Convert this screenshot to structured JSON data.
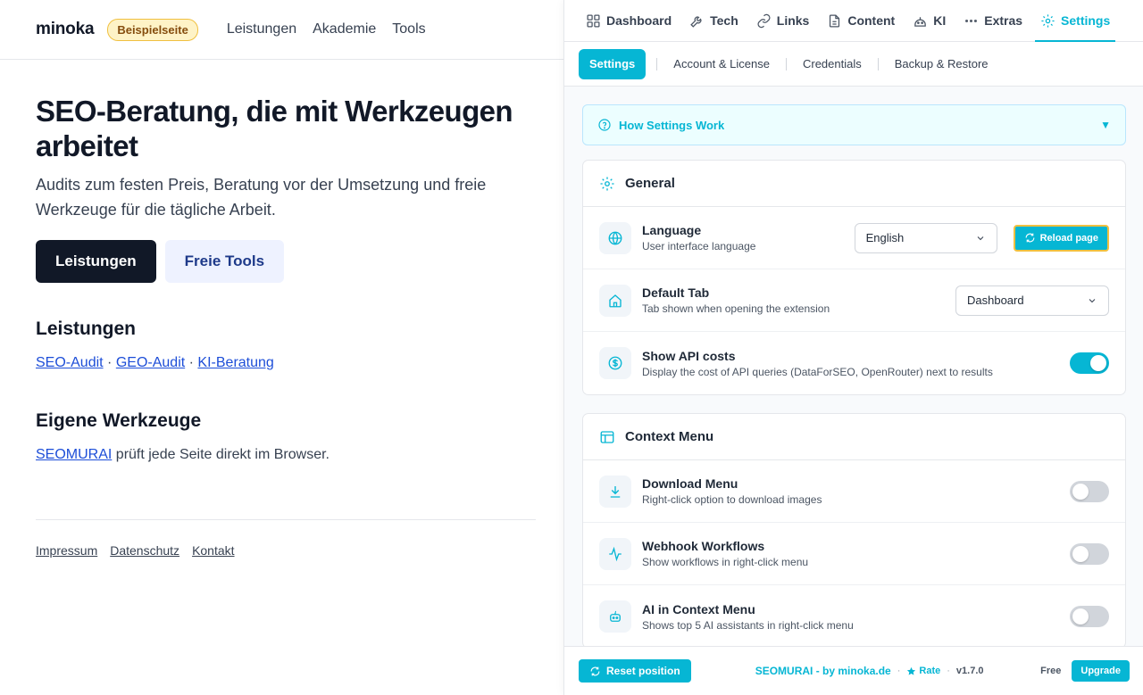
{
  "site": {
    "logo": "minoka",
    "badge": "Beispielseite",
    "nav": [
      "Leistungen",
      "Akademie",
      "Tools"
    ],
    "hero_title": "SEO-Beratung, die mit Werkzeugen arbeitet",
    "hero_sub": "Audits zum festen Preis, Beratung vor der Umsetzung und freie Werkzeuge für die tägliche Arbeit.",
    "cta_primary": "Leistungen",
    "cta_secondary": "Freie Tools",
    "services_heading": "Leistungen",
    "services_links": [
      "SEO-Audit",
      "GEO-Audit",
      "KI-Beratung"
    ],
    "separator": "·",
    "tools_heading": "Eigene Werkzeuge",
    "tools_link": "SEOMURAI",
    "tools_text": " prüft jede Seite direkt im Browser.",
    "footer": [
      "Impressum",
      "Datenschutz",
      "Kontakt"
    ]
  },
  "panel": {
    "tabs": [
      {
        "label": "Dashboard",
        "icon": "grid-icon"
      },
      {
        "label": "Tech",
        "icon": "wrench-icon"
      },
      {
        "label": "Links",
        "icon": "link-icon"
      },
      {
        "label": "Content",
        "icon": "document-icon"
      },
      {
        "label": "KI",
        "icon": "robot-icon"
      },
      {
        "label": "Extras",
        "icon": "dots-icon"
      },
      {
        "label": "Settings",
        "icon": "gear-icon",
        "active": true
      }
    ],
    "subtabs": [
      "Settings",
      "Account & License",
      "Credentials",
      "Backup & Restore"
    ],
    "howto": "How Settings Work",
    "howto_caret": "▼",
    "general": {
      "title": "General",
      "language": {
        "title": "Language",
        "desc": "User interface language",
        "value": "English",
        "reload": "Reload page"
      },
      "default_tab": {
        "title": "Default Tab",
        "desc": "Tab shown when opening the extension",
        "value": "Dashboard"
      },
      "api_costs": {
        "title": "Show API costs",
        "desc": "Display the cost of API queries (DataForSEO, OpenRouter) next to results",
        "enabled": true
      }
    },
    "context_menu": {
      "title": "Context Menu",
      "download": {
        "title": "Download Menu",
        "desc": "Right-click option to download images",
        "enabled": false
      },
      "webhook": {
        "title": "Webhook Workflows",
        "desc": "Show workflows in right-click menu",
        "enabled": false
      },
      "ai": {
        "title": "AI in Context Menu",
        "desc": "Shows top 5 AI assistants in right-click menu",
        "enabled": false
      }
    },
    "footer": {
      "reset": "Reset position",
      "brand": "SEOMURAI - by minoka.de",
      "rate": "Rate",
      "version": "v1.7.0",
      "plan": "Free",
      "upgrade": "Upgrade",
      "separator": "·"
    },
    "colors": {
      "accent": "#06b6d4",
      "badge_bg": "#fef3c7",
      "dark_button": "#111827"
    }
  }
}
